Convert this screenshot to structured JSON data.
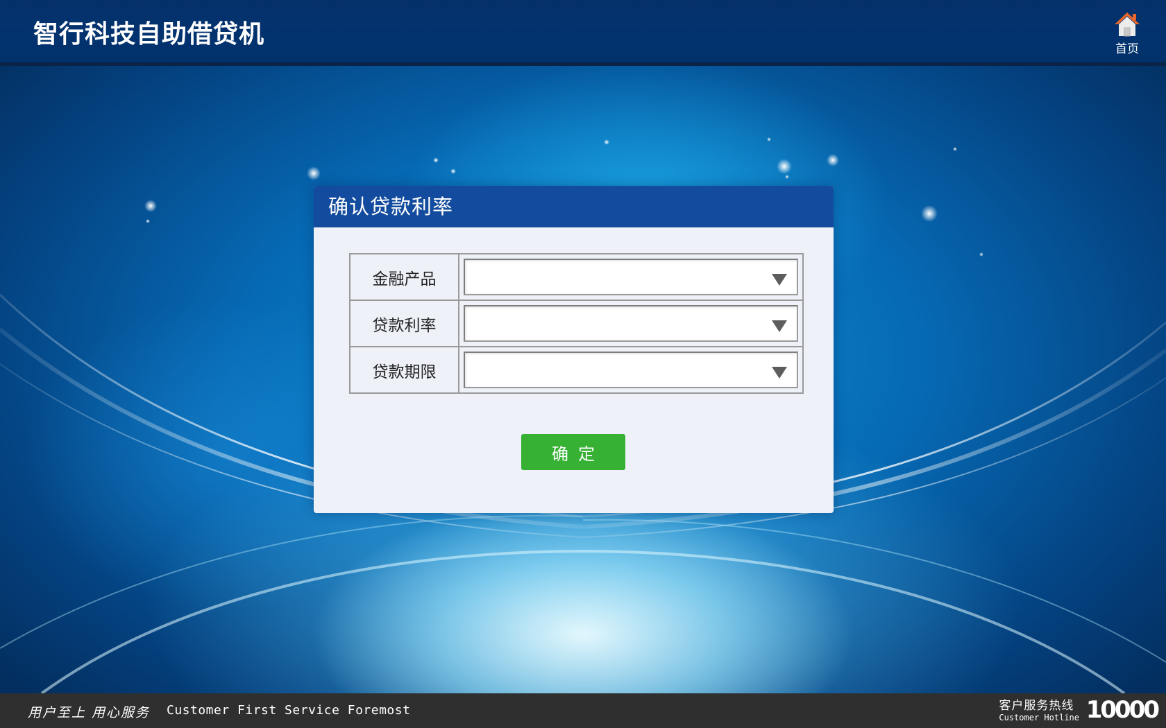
{
  "header": {
    "app_title": "智行科技自助借贷机",
    "home_label": "首页",
    "home_icon": "home-icon"
  },
  "dialog": {
    "title": "确认贷款利率",
    "fields": [
      {
        "label": "金融产品",
        "value": ""
      },
      {
        "label": "贷款利率",
        "value": ""
      },
      {
        "label": "贷款期限",
        "value": ""
      }
    ],
    "confirm_label": "确定"
  },
  "footer": {
    "slogan_cn": "用户至上 用心服务",
    "slogan_en": "Customer First Service Foremost",
    "hotline_cn": "客户服务热线",
    "hotline_en": "Customer Hotline",
    "hotline_number": "10000"
  },
  "colors": {
    "header_bg": "#02336f",
    "dialog_header_bg": "#134c9e",
    "dialog_body_bg": "#eef1f8",
    "confirm_button": "#36b133",
    "footer_bg": "#2f2f2f",
    "home_icon_roof": "#e8662b"
  }
}
